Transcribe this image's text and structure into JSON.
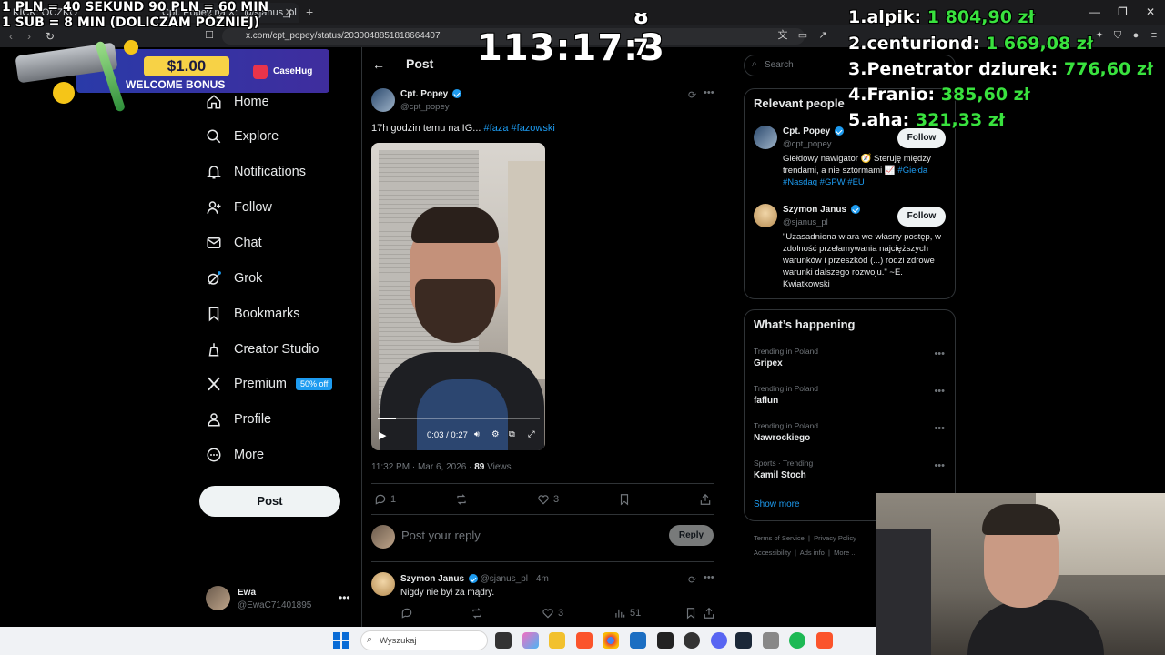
{
  "browser": {
    "tabs": [
      {
        "label": "KICK: OCZKO"
      },
      {
        "label": "Cpt. Popey na X: \"@sjanus_pl 17..."
      }
    ],
    "url": "x.com/cpt_popey/status/2030048851818664407"
  },
  "sidebar": {
    "items": [
      {
        "label": "Home",
        "icon": "home-icon"
      },
      {
        "label": "Explore",
        "icon": "search-icon"
      },
      {
        "label": "Notifications",
        "icon": "bell-icon"
      },
      {
        "label": "Follow",
        "icon": "add-user-icon"
      },
      {
        "label": "Chat",
        "icon": "mail-icon"
      },
      {
        "label": "Grok",
        "icon": "grok-icon"
      },
      {
        "label": "Bookmarks",
        "icon": "bookmark-icon"
      },
      {
        "label": "Creator Studio",
        "icon": "creator-studio-icon"
      },
      {
        "label": "Premium",
        "icon": "x-logo-icon",
        "badge": "50% off"
      },
      {
        "label": "Profile",
        "icon": "person-icon"
      },
      {
        "label": "More",
        "icon": "more-circle-icon"
      }
    ],
    "post_button": "Post",
    "account": {
      "name": "Ewa",
      "handle": "@EwaC71401895"
    }
  },
  "main": {
    "header_title": "Post",
    "post": {
      "author_name": "Cpt. Popey",
      "author_handle": "@cpt_popey",
      "text_prefix": "17h godzin temu na IG... ",
      "hashtag1": "#faza",
      "hashtag2": "#fazowski",
      "video_time": "0:03 / 0:27",
      "video_progress": 0.11,
      "timestamp": "11:32 PM · Mar 6, 2026 · ",
      "views_count": "89",
      "views_label": " Views",
      "replies": "1",
      "likes": "3"
    },
    "reply_box": {
      "placeholder": "Post your reply",
      "button": "Reply"
    },
    "comment": {
      "author_name": "Szymon Janus",
      "author_handle": "@sjanus_pl · 4m",
      "text": "Nigdy nie był za mądry.",
      "likes": "3",
      "views": "51"
    }
  },
  "right": {
    "search_placeholder": "Search",
    "relevant_title": "Relevant people",
    "people": [
      {
        "name": "Cpt. Popey",
        "handle": "@cpt_popey",
        "follow": "Follow",
        "bio": "Giełdowy nawigator 🧭 Steruję między trendami, a nie sztormami 📈",
        "bio_tags": "#Giełda #Nasdaq #GPW #EU"
      },
      {
        "name": "Szymon Janus",
        "handle": "@sjanus_pl",
        "follow": "Follow",
        "bio": "\"Uzasadniona wiara we własny postęp, w zdolność przełamywania najcięższych warunków i przeszkód (...) rodzi zdrowe warunki dalszego rozwoju.\" ~E. Kwiatkowski"
      }
    ],
    "happening_title": "What’s happening",
    "trends": [
      {
        "context": "Trending in Poland",
        "name": "Gripex"
      },
      {
        "context": "Trending in Poland",
        "name": "faflun"
      },
      {
        "context": "Trending in Poland",
        "name": "Nawrockiego"
      },
      {
        "context": "Sports · Trending",
        "name": "Kamil Stoch"
      }
    ],
    "show_more": "Show more",
    "footer": [
      "Terms of Service",
      "Privacy Policy",
      "Accessibility",
      "Ads info",
      "More ..."
    ]
  },
  "overlay": {
    "line1": "1 PLN = 40 SEKUND 90 PLN = 60 MIN",
    "line2": "1 SUB = 8 MIN (DOLICZAM PÓŹNIEJ)",
    "timer": "113:17:3",
    "timer_digit_top": "8",
    "timer_digit_bottom": "7",
    "banner_amount": "$1.00",
    "banner_text": "WELCOME BONUS",
    "banner_brand": "CaseHug",
    "leaderboard": [
      {
        "rank": "1.",
        "name": "alpik:",
        "amount": "1 804,90 zł"
      },
      {
        "rank": "2.",
        "name": "centuriond:",
        "amount": "1 669,08 zł"
      },
      {
        "rank": "3.",
        "name": "Penetrator dziurek:",
        "amount": "776,60 zł"
      },
      {
        "rank": "4.",
        "name": "Franio:",
        "amount": "385,60 zł"
      },
      {
        "rank": "5.",
        "name": "aha:",
        "amount": "321,33 zł"
      }
    ]
  },
  "taskbar": {
    "search_placeholder": "Wyszukaj"
  }
}
